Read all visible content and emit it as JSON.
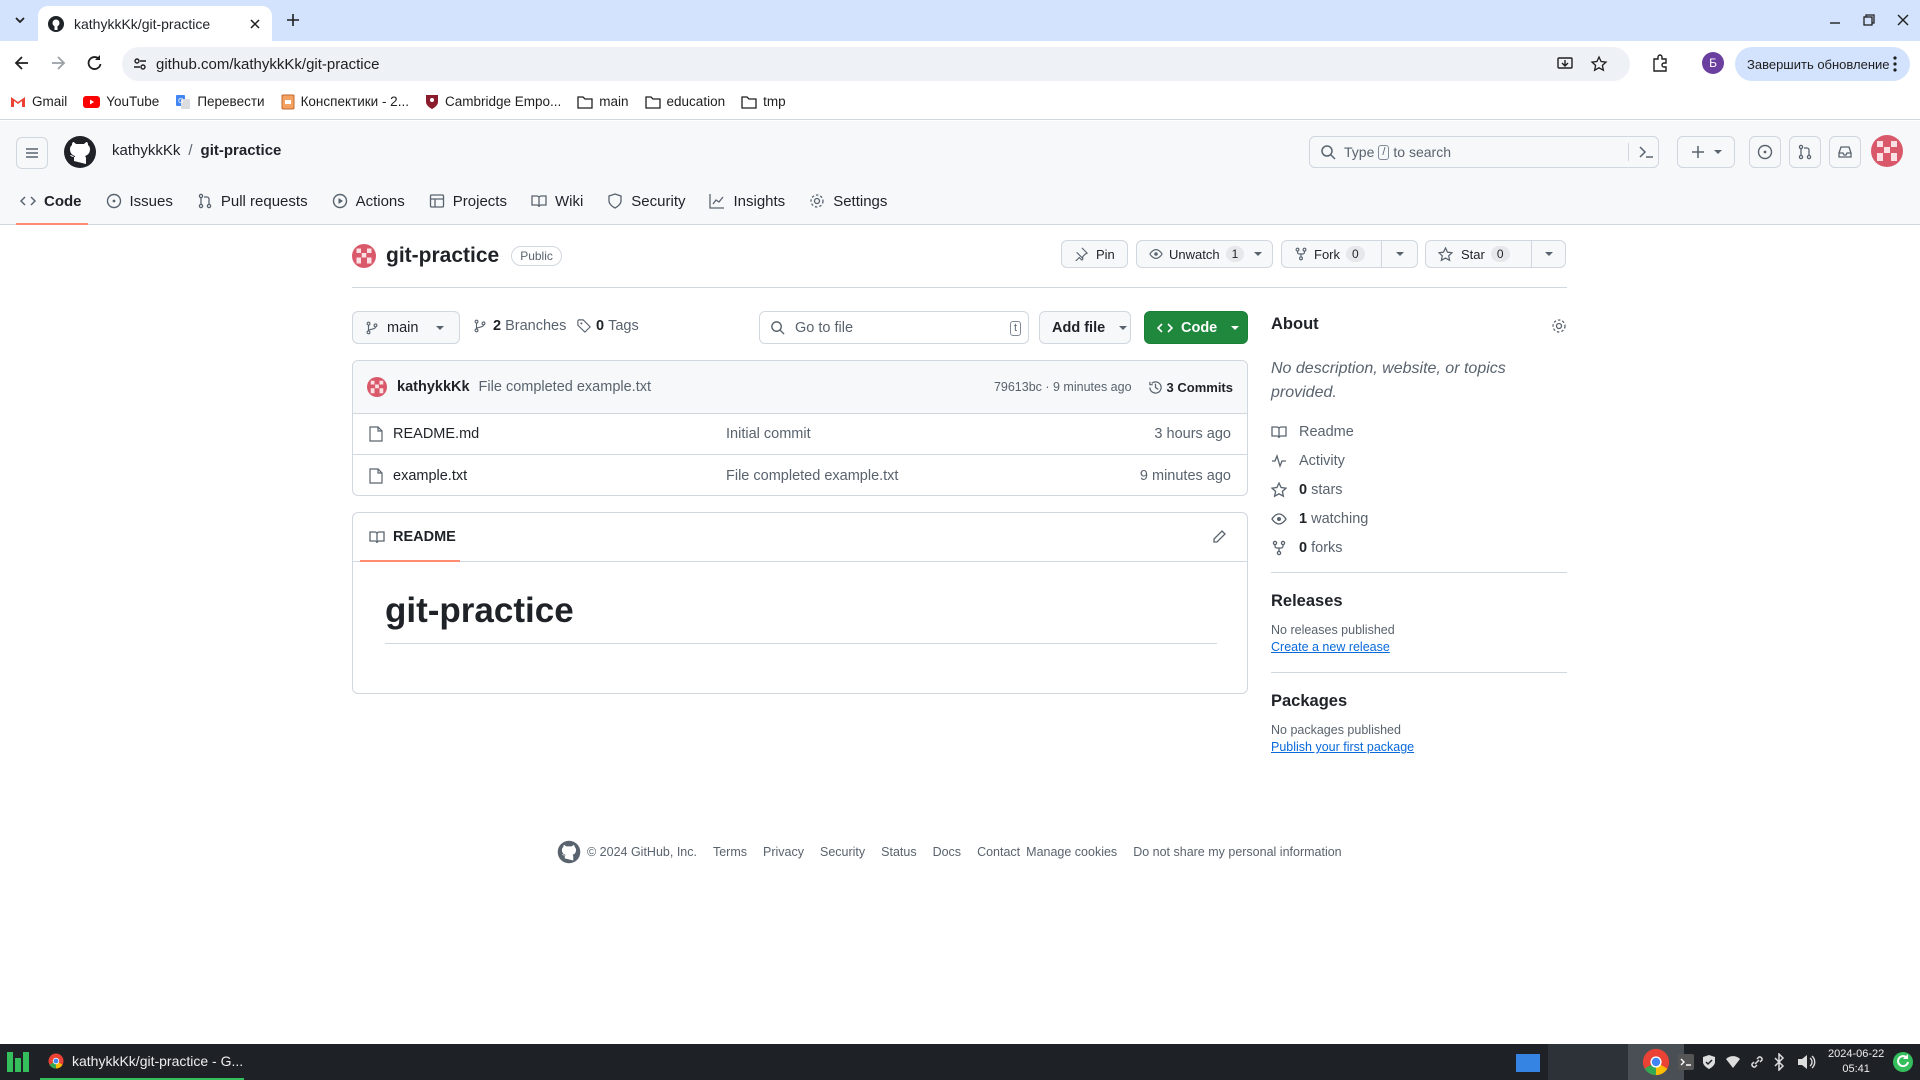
{
  "browser": {
    "tab_title": "kathykkKk/git-practice",
    "url": "github.com/kathykkKk/git-practice",
    "update_button": "Завершить обновление",
    "profile_letter": "Б",
    "bookmarks": [
      "Gmail",
      "YouTube",
      "Перевести",
      "Конспектики - 2...",
      "Cambridge Empo...",
      "main",
      "education",
      "tmp"
    ]
  },
  "gh": {
    "owner": "kathykkKk",
    "separator": "/",
    "repo": "git-practice",
    "search_prefix": "Type",
    "search_key": "/",
    "search_suffix": "to search",
    "nav": [
      "Code",
      "Issues",
      "Pull requests",
      "Actions",
      "Projects",
      "Wiki",
      "Security",
      "Insights",
      "Settings"
    ]
  },
  "repo": {
    "name": "git-practice",
    "visibility": "Public",
    "pin": "Pin",
    "unwatch": "Unwatch",
    "watch_count": "1",
    "fork": "Fork",
    "fork_count": "0",
    "star": "Star",
    "star_count": "0",
    "branch": "main",
    "branches_count": "2",
    "branches_label": "Branches",
    "tags_count": "0",
    "tags_label": "Tags",
    "goto_placeholder": "Go to file",
    "goto_key": "t",
    "add_file": "Add file",
    "code_button": "Code"
  },
  "commit": {
    "author": "kathykkKk",
    "message": "File completed example.txt",
    "sha_time": "79613bc · 9 minutes ago",
    "commits": "3 Commits"
  },
  "files": [
    {
      "name": "README.md",
      "message": "Initial commit",
      "time": "3 hours ago"
    },
    {
      "name": "example.txt",
      "message": "File completed example.txt",
      "time": "9 minutes ago"
    }
  ],
  "readme": {
    "tab": "README",
    "heading": "git-practice"
  },
  "about": {
    "title": "About",
    "description": "No description, website, or topics provided.",
    "readme": "Readme",
    "activity": "Activity",
    "stars_count": "0",
    "stars_label": "stars",
    "watching_count": "1",
    "watching_label": "watching",
    "forks_count": "0",
    "forks_label": "forks",
    "releases_title": "Releases",
    "releases_text": "No releases published",
    "releases_link": "Create a new release",
    "packages_title": "Packages",
    "packages_text": "No packages published",
    "packages_link": "Publish your first package"
  },
  "footer": [
    "© 2024 GitHub, Inc.",
    "Terms",
    "Privacy",
    "Security",
    "Status",
    "Docs",
    "Contact",
    "Manage cookies",
    "Do not share my personal information"
  ],
  "taskbar": {
    "window_title": "kathykkKk/git-practice - G...",
    "date": "2024-06-22",
    "time": "05:41"
  }
}
